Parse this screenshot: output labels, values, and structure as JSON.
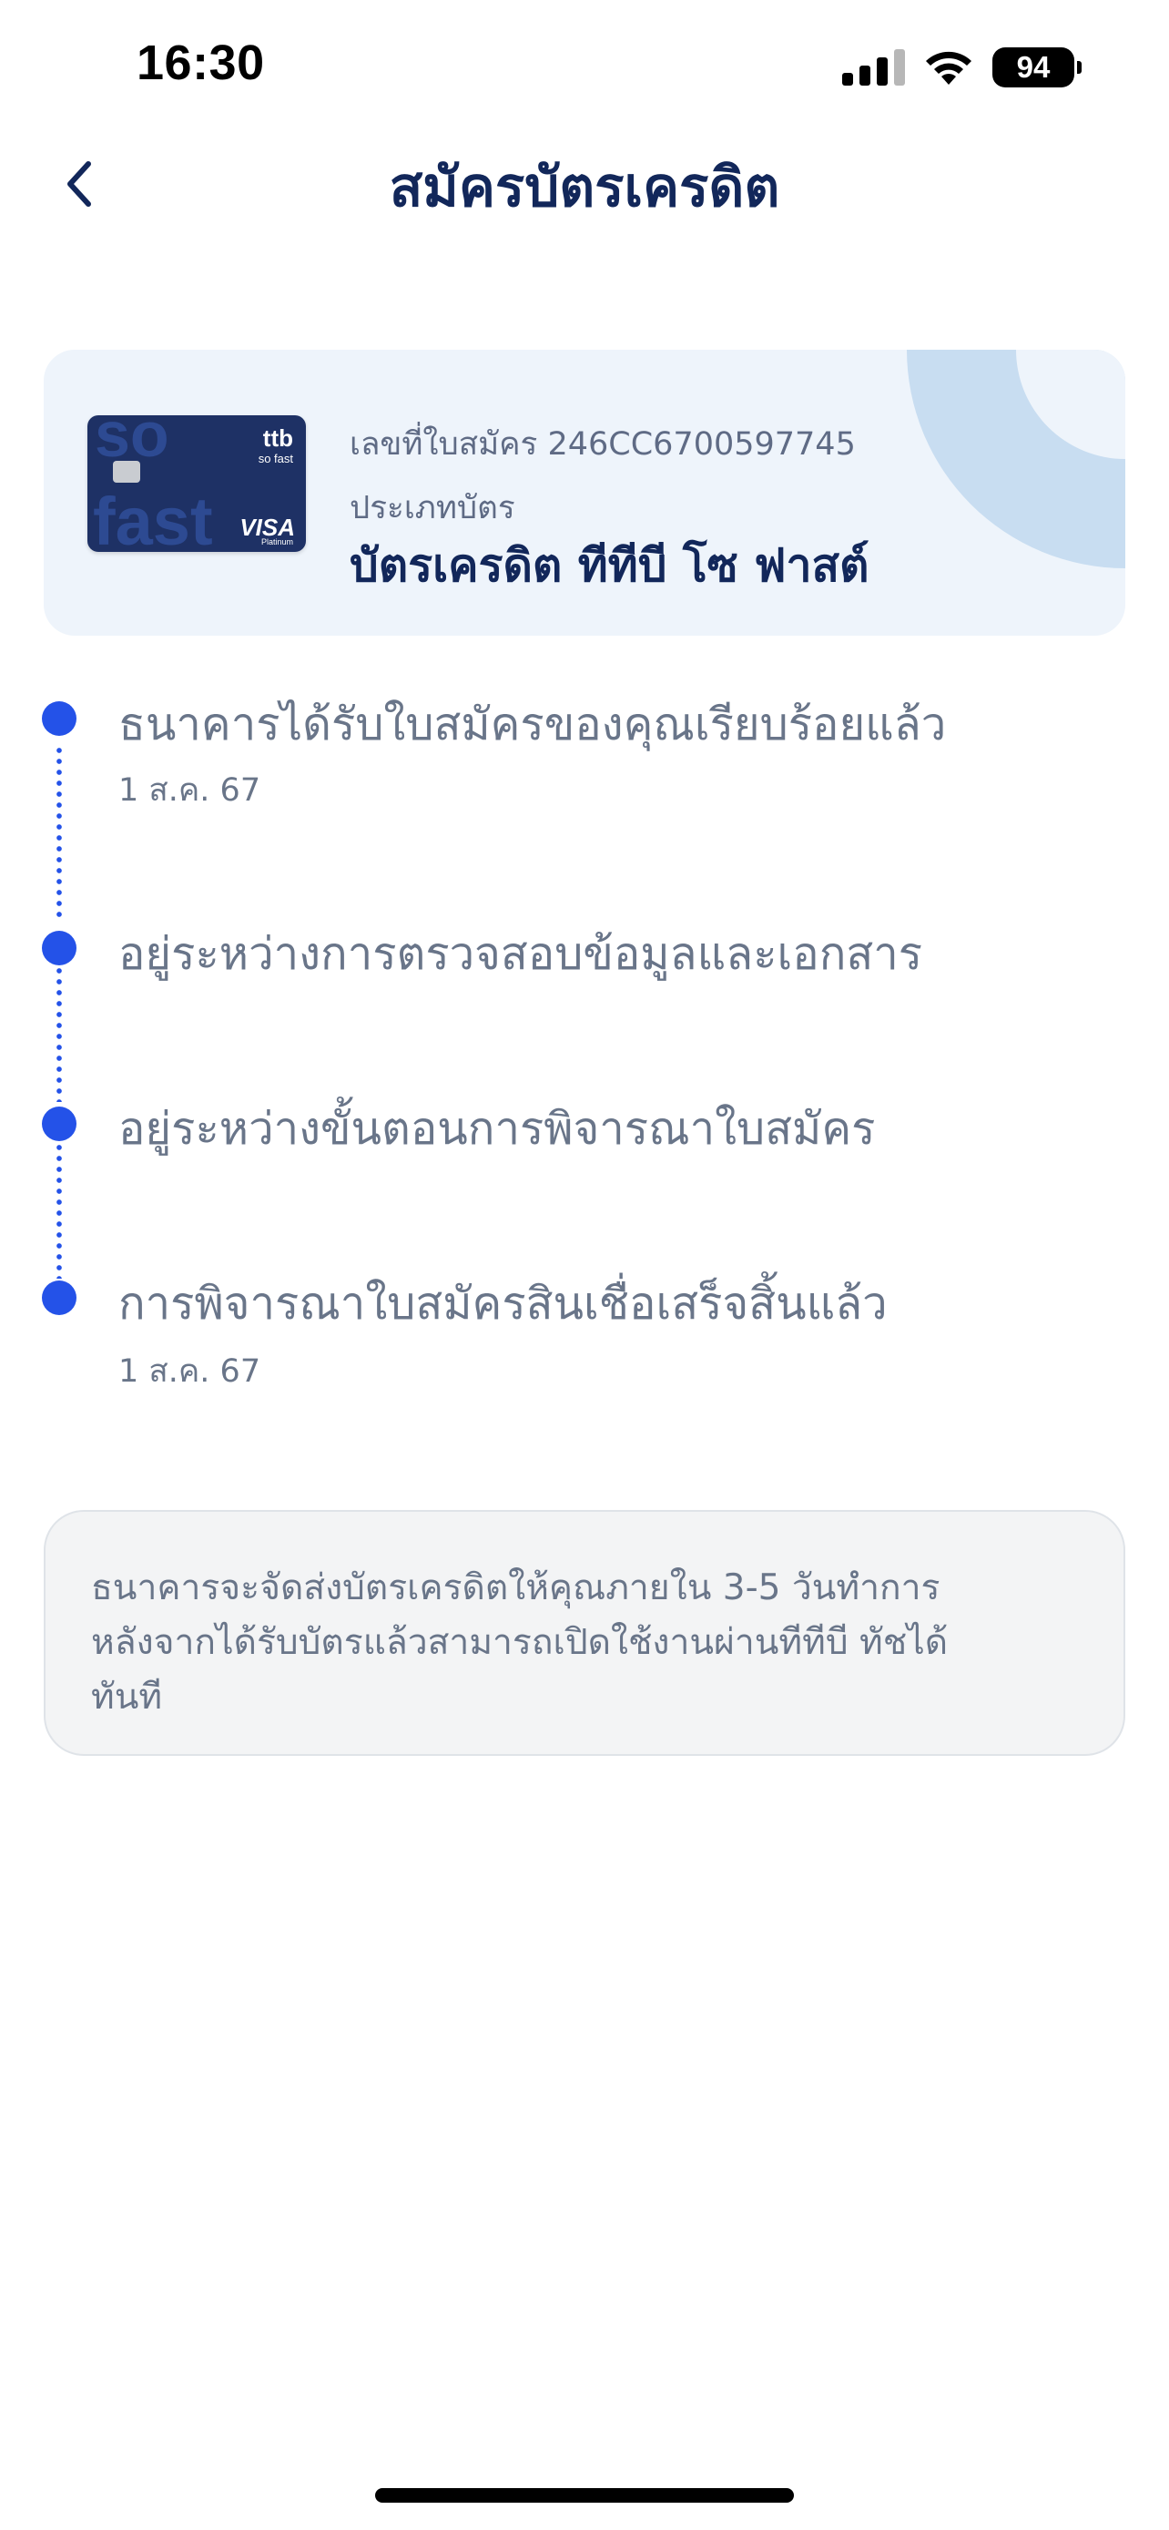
{
  "status_bar": {
    "time": "16:30",
    "battery_level": "94",
    "icons": [
      "cellular-signal-icon",
      "wifi-icon",
      "battery-icon"
    ]
  },
  "header": {
    "back_icon": "chevron-left-icon",
    "title": "สมัครบัตรเครดิต"
  },
  "application": {
    "number_label": "เลขที่ใบสมัคร 246CC6700597745",
    "card_type_label": "ประเภทบัตร",
    "card_type_value": "บัตรเครดิต ทีทีบี โซ ฟาสต์",
    "card_image": {
      "brand": "ttb",
      "product": "so fast",
      "network": "VISA",
      "tier": "Platinum",
      "big_text_top": "so",
      "big_text_bottom": "fast"
    }
  },
  "timeline": [
    {
      "title": "ธนาคารได้รับใบสมัครของคุณเรียบร้อยแล้ว",
      "date": "1 ส.ค. 67"
    },
    {
      "title": "อยู่ระหว่างการตรวจสอบข้อมูลและเอกสาร",
      "date": ""
    },
    {
      "title": "อยู่ระหว่างขั้นตอนการพิจารณาใบสมัคร",
      "date": ""
    },
    {
      "title": "การพิจารณาใบสมัครสินเชื่อเสร็จสิ้นแล้ว",
      "date": "1 ส.ค. 67"
    }
  ],
  "info": {
    "line1": "ธนาคารจะจัดส่งบัตรเครดิตให้คุณภายใน 3-5 วันทำการ",
    "line2": "หลังจากได้รับบัตรแล้วสามารถเปิดใช้งานผ่านทีทีบี ทัชได้",
    "line3": "ทันที"
  },
  "colors": {
    "accent": "#2452e8",
    "title": "#12275a",
    "muted_text": "#697589",
    "panel_bg": "#eef4fb"
  }
}
